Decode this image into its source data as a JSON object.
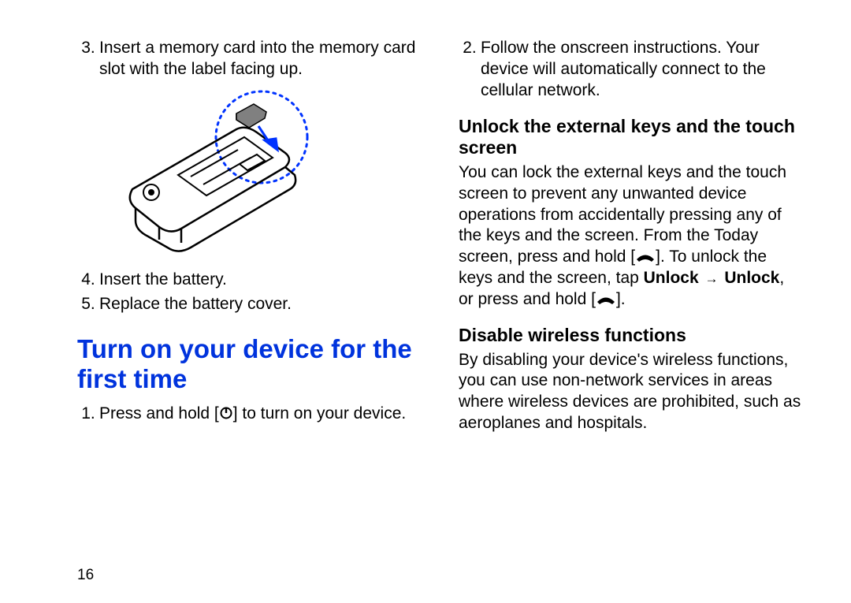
{
  "page_number": "16",
  "left": {
    "step3_num": "3.",
    "step3_text": "Insert a memory card into the memory card slot with the label facing up.",
    "step4_num": "4.",
    "step4_text": "Insert the battery.",
    "step5_num": "5.",
    "step5_text": "Replace the battery cover.",
    "section_title": "Turn on your device for the first time",
    "step1_num": "1.",
    "step1_pre": "Press and hold [",
    "step1_post": "] to turn on your device."
  },
  "right": {
    "step2_num": "2.",
    "step2_text": "Follow the onscreen instructions. Your device will automatically connect to the cellular network.",
    "unlock_title": "Unlock the external keys and the touch screen",
    "unlock_pre": "You can lock the external keys and the touch screen to prevent any unwanted device operations from accidentally pressing any of the keys and the screen. From the Today screen, press and hold [",
    "unlock_mid": "]. To unlock the keys and the screen, tap ",
    "unlock_bold1": "Unlock",
    "unlock_arrow": "→",
    "unlock_bold2": "Unlock",
    "unlock_post1": ", or press and hold [",
    "unlock_post2": "].",
    "disable_title": "Disable wireless functions",
    "disable_text": "By disabling your device's wireless functions, you can use non-network services in areas where wireless devices are prohibited, such as aeroplanes and hospitals."
  },
  "icons": {
    "power": "power-icon",
    "end": "end-call-icon"
  }
}
